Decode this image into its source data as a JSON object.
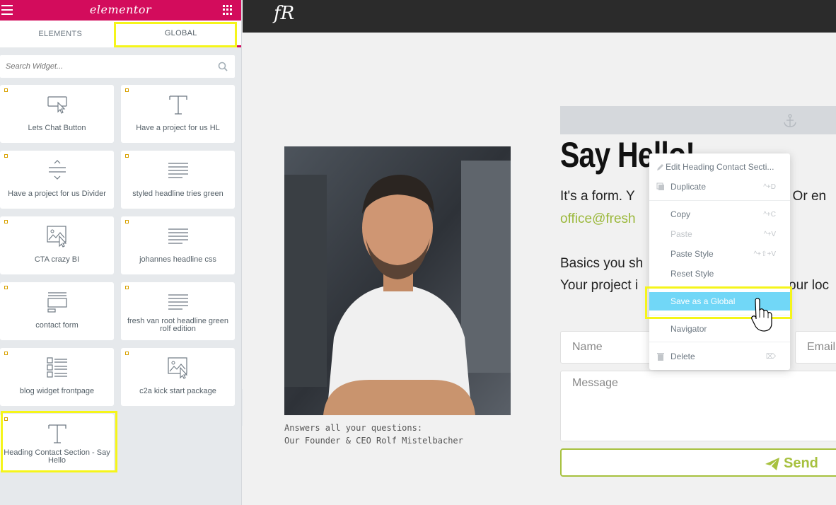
{
  "panel": {
    "logo": "elementor",
    "tabs": [
      "ELEMENTS",
      "GLOBAL"
    ],
    "search_placeholder": "Search Widget...",
    "widgets": [
      {
        "title": "Lets Chat Button",
        "icon": "button-pointer-icon"
      },
      {
        "title": "Have a project for us HL",
        "icon": "text-t-icon"
      },
      {
        "title": "Have a project for us Divider",
        "icon": "divider-icon"
      },
      {
        "title": "styled headline tries green",
        "icon": "text-align-icon"
      },
      {
        "title": "CTA crazy BI",
        "icon": "image-pointer-icon"
      },
      {
        "title": "johannes headline css",
        "icon": "text-align-icon"
      },
      {
        "title": "contact form",
        "icon": "form-icon"
      },
      {
        "title": "fresh van root headline green rolf edition",
        "icon": "text-align-icon"
      },
      {
        "title": "blog widget frontpage",
        "icon": "post-list-icon"
      },
      {
        "title": "c2a kick start package",
        "icon": "image-pointer-icon"
      },
      {
        "title": "Heading Contact Section - Say Hello",
        "icon": "text-t-icon"
      }
    ]
  },
  "preview": {
    "site_logo": "fR",
    "heading": "Say Hello!",
    "line1": "It's a form. Y",
    "line1_right": ". Or en",
    "email": "office@fresh",
    "line2": "Basics you sh",
    "line3": "Your project i",
    "line3_right": "our loc",
    "name_placeholder": "Name",
    "email_placeholder": "Email",
    "message_placeholder": "Message",
    "send_label": "Send",
    "caption1": "Answers all your questions:",
    "caption2": "Our Founder & CEO Rolf Mistelbacher"
  },
  "context_menu": {
    "items": [
      {
        "label": "Edit Heading Contact Secti...",
        "shortcut": ""
      },
      {
        "label": "Duplicate",
        "shortcut": "^+D"
      },
      {
        "label": "Copy",
        "shortcut": "^+C"
      },
      {
        "label": "Paste",
        "shortcut": "^+V"
      },
      {
        "label": "Paste Style",
        "shortcut": "^+⇧+V"
      },
      {
        "label": "Reset Style",
        "shortcut": ""
      },
      {
        "label": "Save as a Global",
        "shortcut": ""
      },
      {
        "label": "Navigator",
        "shortcut": ""
      },
      {
        "label": "Delete",
        "shortcut": "⌦"
      }
    ]
  },
  "colors": {
    "brand": "#d30c5c",
    "highlight": "#f5f51a",
    "accent_green": "#9bb83b",
    "menu_selected": "#71d7f7"
  }
}
